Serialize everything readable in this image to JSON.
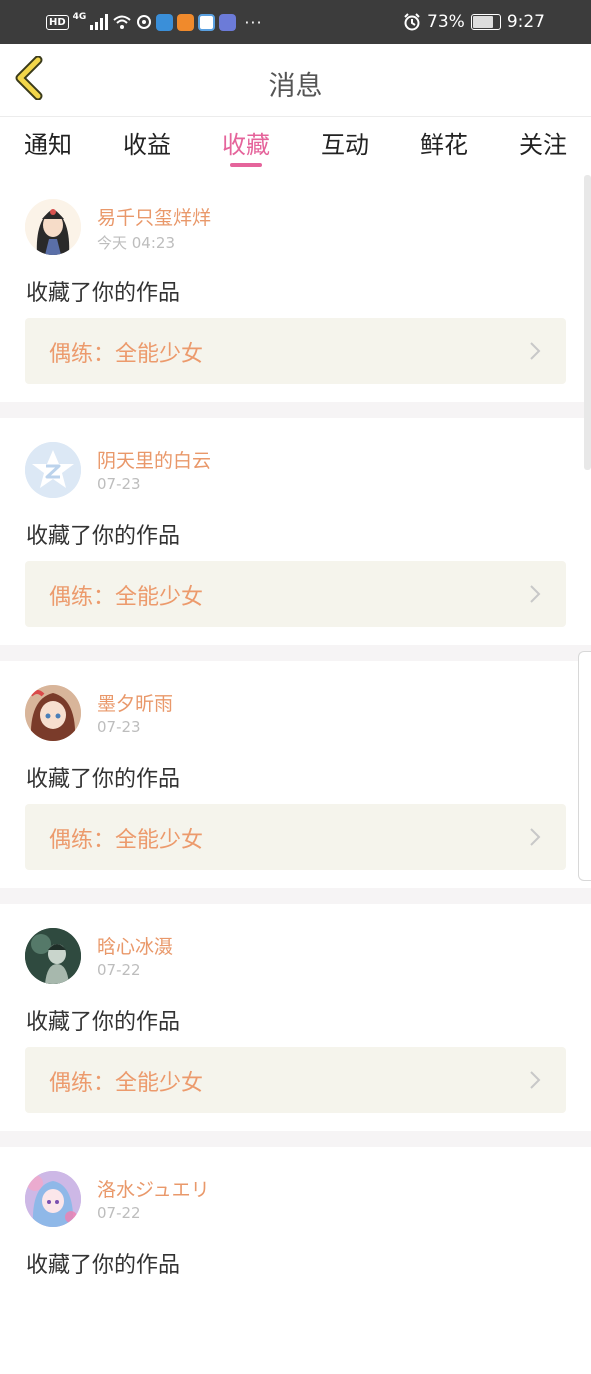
{
  "status_bar": {
    "hd": "HD",
    "network": "4G",
    "battery": "73%",
    "time": "9:27",
    "more": "···",
    "icons": [
      "signal-icon",
      "wifi-icon",
      "app-icon",
      "app-icon",
      "app-icon",
      "app-icon",
      "app-icon",
      "alarm-icon",
      "battery-icon"
    ]
  },
  "header": {
    "title": "消息",
    "back_icon": "chevron-left-icon"
  },
  "tabs": [
    {
      "label": "通知",
      "active": false
    },
    {
      "label": "收益",
      "active": false
    },
    {
      "label": "收藏",
      "active": true
    },
    {
      "label": "互动",
      "active": false
    },
    {
      "label": "鲜花",
      "active": false
    },
    {
      "label": "关注",
      "active": false
    }
  ],
  "messages": [
    {
      "user": "易千只玺烊烊",
      "time": "今天 04:23",
      "action": "收藏了你的作品",
      "work": "偶练：全能少女"
    },
    {
      "user": "阴天里的白云",
      "time": "07-23",
      "action": "收藏了你的作品",
      "work": "偶练：全能少女"
    },
    {
      "user": "墨夕昕雨",
      "time": "07-23",
      "action": "收藏了你的作品",
      "work": "偶练：全能少女"
    },
    {
      "user": "晗心冰滠",
      "time": "07-22",
      "action": "收藏了你的作品",
      "work": "偶练：全能少女"
    },
    {
      "user": "洛水ジュエリ",
      "time": "07-22",
      "action": "收藏了你的作品",
      "work": ""
    }
  ],
  "colors": {
    "accent": "#e5649b",
    "username": "#e9986a",
    "work_text": "#ec9a6c",
    "work_bg": "#f5f4ec",
    "separator": "#f6f4f5"
  }
}
